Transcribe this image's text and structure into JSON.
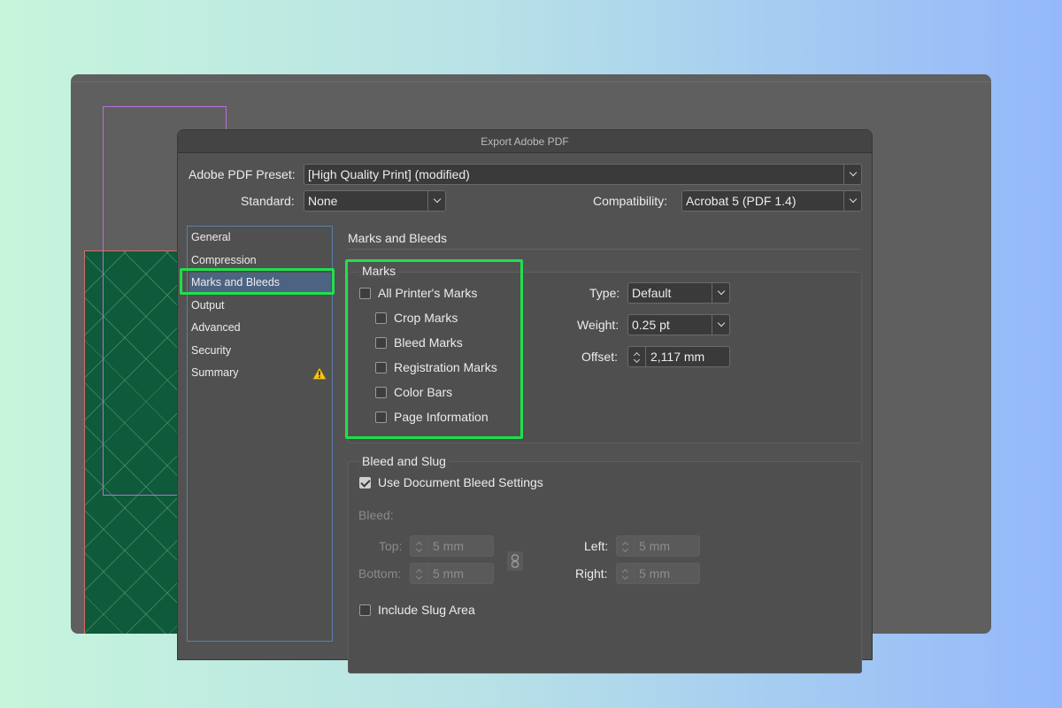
{
  "dialog": {
    "title": "Export Adobe PDF"
  },
  "preset": {
    "label": "Adobe PDF Preset:",
    "value": "[High Quality Print] (modified)"
  },
  "standard": {
    "label": "Standard:",
    "value": "None"
  },
  "compatibility": {
    "label": "Compatibility:",
    "value": "Acrobat 5 (PDF 1.4)"
  },
  "sidebar": {
    "items": [
      {
        "label": "General"
      },
      {
        "label": "Compression"
      },
      {
        "label": "Marks and Bleeds"
      },
      {
        "label": "Output"
      },
      {
        "label": "Advanced"
      },
      {
        "label": "Security"
      },
      {
        "label": "Summary"
      }
    ],
    "selected": "Marks and Bleeds"
  },
  "section": {
    "title": "Marks and Bleeds"
  },
  "marks": {
    "group_label": "Marks",
    "all_printers_marks": {
      "label": "All Printer's Marks",
      "checked": false
    },
    "crop_marks": {
      "label": "Crop Marks",
      "checked": false
    },
    "bleed_marks": {
      "label": "Bleed Marks",
      "checked": false
    },
    "registration_marks": {
      "label": "Registration Marks",
      "checked": false
    },
    "color_bars": {
      "label": "Color Bars",
      "checked": false
    },
    "page_information": {
      "label": "Page Information",
      "checked": false
    },
    "type": {
      "label": "Type:",
      "value": "Default"
    },
    "weight": {
      "label": "Weight:",
      "value": "0.25 pt"
    },
    "offset": {
      "label": "Offset:",
      "value": "2,117 mm"
    }
  },
  "bleed_slug": {
    "group_label": "Bleed and Slug",
    "use_doc_bleed": {
      "label": "Use Document Bleed Settings",
      "checked": true
    },
    "bleed_label": "Bleed:",
    "top": {
      "label": "Top:",
      "value": "5 mm"
    },
    "bottom": {
      "label": "Bottom:",
      "value": "5 mm"
    },
    "left": {
      "label": "Left:",
      "value": "5 mm"
    },
    "right": {
      "label": "Right:",
      "value": "5 mm"
    },
    "include_slug": {
      "label": "Include Slug Area",
      "checked": false
    }
  },
  "colors": {
    "highlight": "#1fe04a",
    "selected_item": "#4c6482",
    "warning": "#f5c518"
  }
}
